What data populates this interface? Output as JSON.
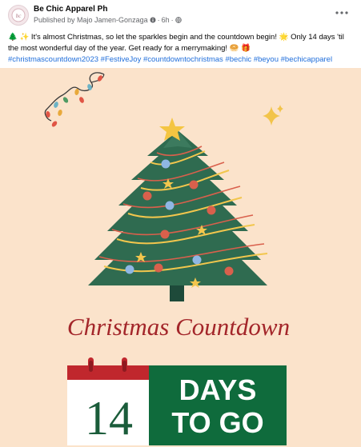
{
  "post": {
    "page_name": "Be Chic Apparel Ph",
    "published_by": "Published by Majo Jamen-Gonzaga",
    "time": "6h",
    "caption": "🌲 ✨ It's almost Christmas, so let the sparkles begin and the countdown begin! 🌟 Only 14 days 'til the most wonderful day of the year. Get ready for a merrymaking! 🥯 🎁",
    "hashtags": [
      "#christmascountdown2023",
      "#FestiveJoy",
      "#countdowntochristmas",
      "#bechic",
      "#beyou",
      "#bechicapparel"
    ]
  },
  "image": {
    "title": "Christmas Countdown",
    "number": "14",
    "days": "DAYS",
    "to_go": "TO GO"
  },
  "colors": {
    "background": "#fbe3cb",
    "red": "#c0272d",
    "green": "#0f6b3c",
    "tree": "#2f6b50",
    "title": "#a3262a"
  },
  "icons": [
    "more-icon",
    "globe-icon",
    "info-icon",
    "star-icon",
    "sparkle-icon"
  ]
}
